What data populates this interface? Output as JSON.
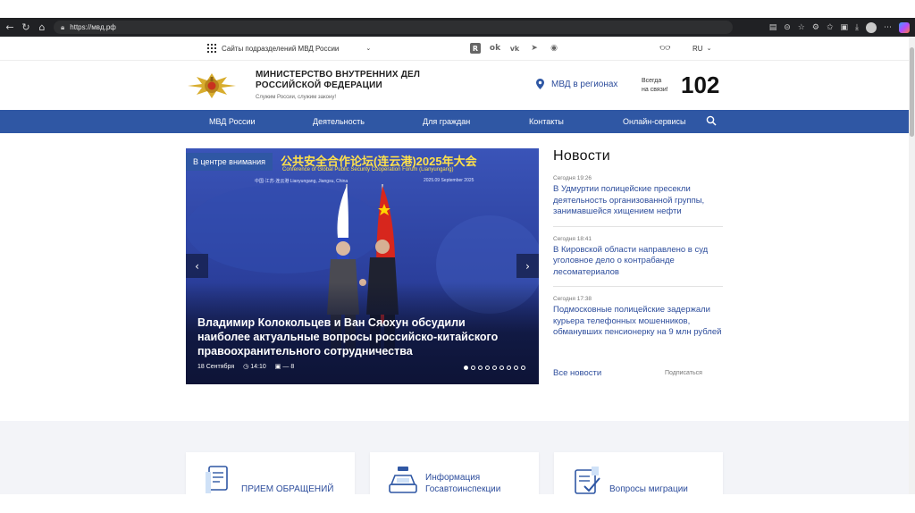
{
  "browser": {
    "url": "https://мвд.рф",
    "nav_icons": [
      "back-icon",
      "reload-icon",
      "home-icon"
    ]
  },
  "topbar": {
    "subsites_label": "Сайты подразделений МВД России",
    "socials": [
      "rutube-icon",
      "ok-icon",
      "vk-icon",
      "telegram-icon",
      "max-icon"
    ],
    "language": "RU"
  },
  "header": {
    "title_line1": "МИНИСТЕРСТВО ВНУТРЕННИХ ДЕЛ",
    "title_line2": "РОССИЙСКОЙ ФЕДЕРАЦИИ",
    "slogan": "Служим России, служим закону!",
    "regions_label": "МВД в регионах",
    "always_line1": "Всегда",
    "always_line2": "на связи!",
    "hotline": "102"
  },
  "nav": {
    "items": [
      "МВД России",
      "Деятельность",
      "Для граждан",
      "Контакты",
      "Онлайн-сервисы"
    ]
  },
  "hero": {
    "badge": "В центре внимания",
    "banner_title": "公共安全合作论坛(连云港)2025年大会",
    "banner_subtitle": "Conference of Global Public Security Cooperation Forum (Lianyungang)",
    "banner_location": "中国·江苏·连云港    Lianyungang, Jiangsu, China",
    "banner_date": "2025.09    September 2025",
    "caption": "Владимир Колокольцев и Ван Сяохун обсудили наиболее актуальные вопросы российско-китайского правоохранительного сотрудничества",
    "date": "18 Сентября",
    "time": "14:10",
    "photos": "— 8",
    "slides_total": 9,
    "slide_active": 1
  },
  "news": {
    "heading": "Новости",
    "items": [
      {
        "time": "Сегодня 19:26",
        "title": "В Удмуртии полицейские пресекли деятельность организованной группы, занимавшейся хищением нефти"
      },
      {
        "time": "Сегодня 18:41",
        "title": "В Кировской области направлено в суд уголовное дело о контрабанде лесоматериалов"
      },
      {
        "time": "Сегодня 17:38",
        "title": "Подмосковные полицейские задержали курьера телефонных мошенников, обманувших пенсионерку на 9 млн рублей"
      }
    ],
    "all_link": "Все новости",
    "subscribe": "Подписаться"
  },
  "cards": [
    {
      "label": "ПРИЕМ ОБРАЩЕНИЙ"
    },
    {
      "label": "Информация Госавтоинспекции"
    },
    {
      "label": "Вопросы миграции"
    }
  ],
  "colors": {
    "brand_blue": "#2f57a4",
    "link_blue": "#2d4d9c",
    "banner_yellow": "#ffe14a"
  }
}
